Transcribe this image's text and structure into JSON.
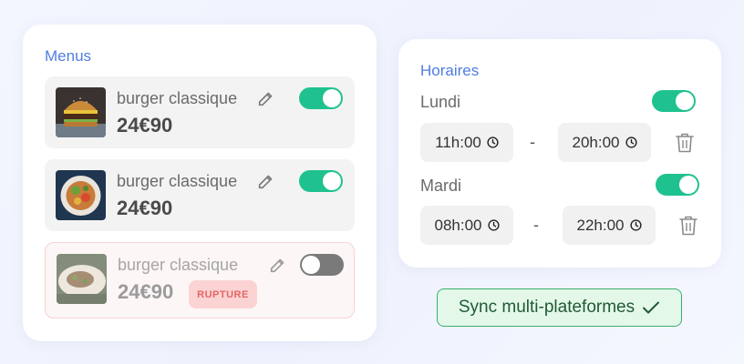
{
  "menus": {
    "title": "Menus",
    "items": [
      {
        "name": "burger classique",
        "price": "24€90",
        "enabled": true,
        "image": "burger-photo"
      },
      {
        "name": "burger classique",
        "price": "24€90",
        "enabled": true,
        "image": "salad-bowl-photo"
      },
      {
        "name": "burger classique",
        "price": "24€90",
        "enabled": false,
        "image": "plate-photo",
        "badge": "RUPTURE"
      }
    ]
  },
  "hours": {
    "title": "Horaires",
    "days": [
      {
        "label": "Lundi",
        "enabled": true,
        "open": "11h:00",
        "close": "20h:00",
        "separator": "-"
      },
      {
        "label": "Mardi",
        "enabled": true,
        "open": "08h:00",
        "close": "22h:00",
        "separator": "-"
      }
    ]
  },
  "sync": {
    "label": "Sync multi-plateformes",
    "icon": "checkmark-icon"
  },
  "colors": {
    "accent_blue": "#4f7de0",
    "toggle_on": "#1fc28f",
    "toggle_off": "#7a7a7a",
    "badge_bg": "#fbd3d3",
    "badge_text": "#e66565",
    "sync_bg": "#e4f8ea",
    "sync_border": "#36b06a"
  }
}
